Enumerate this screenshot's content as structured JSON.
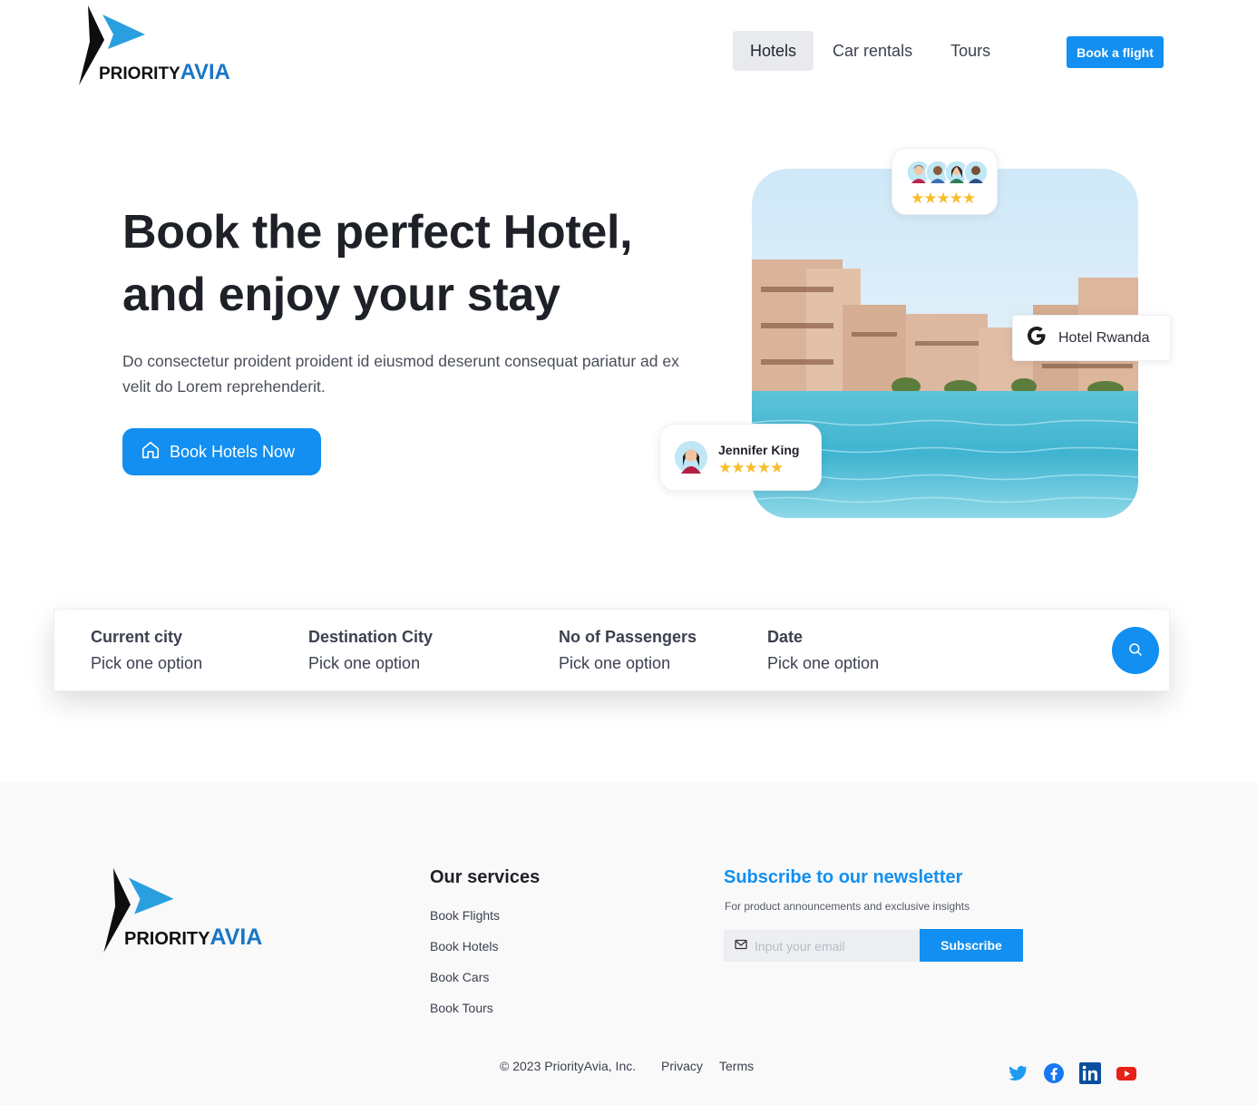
{
  "header": {
    "logo": {
      "word1": "PRIORITY",
      "word2": "AVIA"
    },
    "nav": [
      {
        "label": "Hotels",
        "active": true
      },
      {
        "label": "Car rentals",
        "active": false
      },
      {
        "label": "Tours",
        "active": false
      }
    ],
    "cta_label": "Book a flight"
  },
  "hero": {
    "title_line1": "Book the perfect Hotel,",
    "title_line2": "and enjoy your stay",
    "description": "Do consectetur proident proident id eiusmod deserunt consequat pariatur ad ex velit do Lorem reprehenderit.",
    "button_label": "Book Hotels Now",
    "button_icon": "home-icon",
    "rating_stars": "★★★★★",
    "google_card_label": "Hotel Rwanda",
    "review": {
      "name": "Jennifer King",
      "stars": "★★★★★"
    }
  },
  "search": {
    "fields": [
      {
        "label": "Current city",
        "value": "Pick one option"
      },
      {
        "label": "Destination City",
        "value": "Pick one option"
      },
      {
        "label": "No of Passengers",
        "value": "Pick one option"
      },
      {
        "label": "Date",
        "value": "Pick one option"
      }
    ],
    "button_icon": "search-icon"
  },
  "footer": {
    "services_title": "Our services",
    "services": [
      "Book Flights",
      "Book Hotels",
      "Book Cars",
      "Book Tours"
    ],
    "newsletter": {
      "title": "Subscribe to our newsletter",
      "subtitle": "For product announcements and exclusive insights",
      "placeholder": "Input your email",
      "button_label": "Subscribe"
    },
    "copyright": "© 2023 PriorityAvia, Inc.",
    "links": [
      "Privacy",
      "Terms"
    ],
    "social": [
      "twitter-icon",
      "facebook-icon",
      "linkedin-icon",
      "youtube-icon"
    ]
  },
  "colors": {
    "accent": "#128ff0",
    "logo_blue": "#1976c5",
    "star": "#f7be2c"
  }
}
